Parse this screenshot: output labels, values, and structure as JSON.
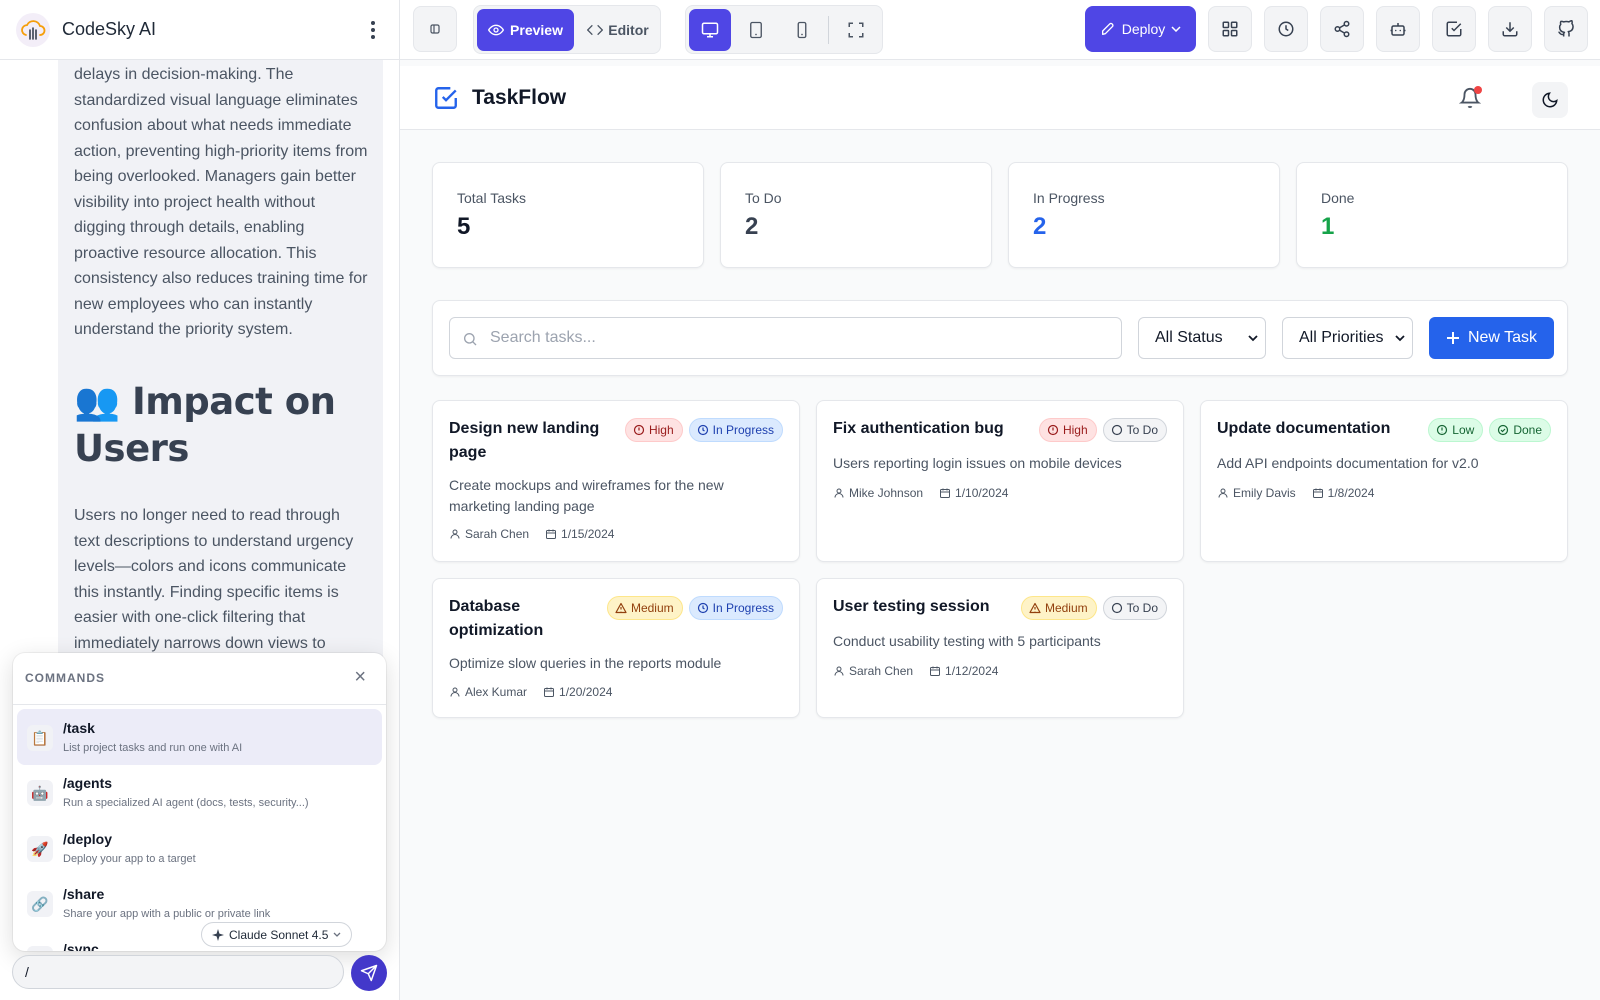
{
  "app": {
    "name": "CodeSky AI"
  },
  "chat": {
    "paragraph1": "delays in decision-making. The standardized visual language eliminates confusion about what needs immediate action, preventing high-priority items from being overlooked. Managers gain better visibility into project health without digging through details, enabling proactive resource allocation. This consistency also reduces training time for new employees who can instantly understand the priority system.",
    "heading": "👥 Impact on Users",
    "paragraph2": "Users no longer need to read through text descriptions to understand urgency levels—colors and icons communicate this instantly. Finding specific items is easier with one-click filtering that immediately narrows down views to relevant tasks."
  },
  "commands": {
    "title": "COMMANDS",
    "close": "×",
    "items": [
      {
        "name": "/task",
        "desc": "List project tasks and run one with AI",
        "icon": "📋"
      },
      {
        "name": "/agents",
        "desc": "Run a specialized AI agent (docs, tests, security...)",
        "icon": "🤖"
      },
      {
        "name": "/deploy",
        "desc": "Deploy your app to a target",
        "icon": "🚀"
      },
      {
        "name": "/share",
        "desc": "Share your app with a public or private link",
        "icon": "🔗"
      },
      {
        "name": "/sync",
        "desc": "",
        "icon": "🔄"
      }
    ]
  },
  "model": {
    "label": "Claude Sonnet 4.5"
  },
  "input": {
    "value": "/"
  },
  "toolbar": {
    "preview_label": "Preview",
    "editor_label": "Editor",
    "deploy_label": "Deploy",
    "accent": "#4f46e5"
  },
  "taskflow": {
    "title": "TaskFlow",
    "stats": [
      {
        "label": "Total Tasks",
        "value": "5",
        "color": "#111827"
      },
      {
        "label": "To Do",
        "value": "2",
        "color": "#374151"
      },
      {
        "label": "In Progress",
        "value": "2",
        "color": "#2563eb"
      },
      {
        "label": "Done",
        "value": "1",
        "color": "#16a34a"
      }
    ],
    "search_placeholder": "Search tasks...",
    "status_filter": "All Status",
    "priority_filter": "All Priorities",
    "new_task_label": "New Task",
    "tasks": [
      {
        "title": "Design new landing page",
        "priority": "High",
        "status": "In Progress",
        "desc": "Create mockups and wireframes for the new marketing landing page",
        "assignee": "Sarah Chen",
        "date": "1/15/2024"
      },
      {
        "title": "Fix authentication bug",
        "priority": "High",
        "status": "To Do",
        "desc": "Users reporting login issues on mobile devices",
        "assignee": "Mike Johnson",
        "date": "1/10/2024"
      },
      {
        "title": "Update documentation",
        "priority": "Low",
        "status": "Done",
        "desc": "Add API endpoints documentation for v2.0",
        "assignee": "Emily Davis",
        "date": "1/8/2024"
      },
      {
        "title": "Database optimization",
        "priority": "Medium",
        "status": "In Progress",
        "desc": "Optimize slow queries in the reports module",
        "assignee": "Alex Kumar",
        "date": "1/20/2024"
      },
      {
        "title": "User testing session",
        "priority": "Medium",
        "status": "To Do",
        "desc": "Conduct usability testing with 5 participants",
        "assignee": "Sarah Chen",
        "date": "1/12/2024"
      }
    ]
  }
}
